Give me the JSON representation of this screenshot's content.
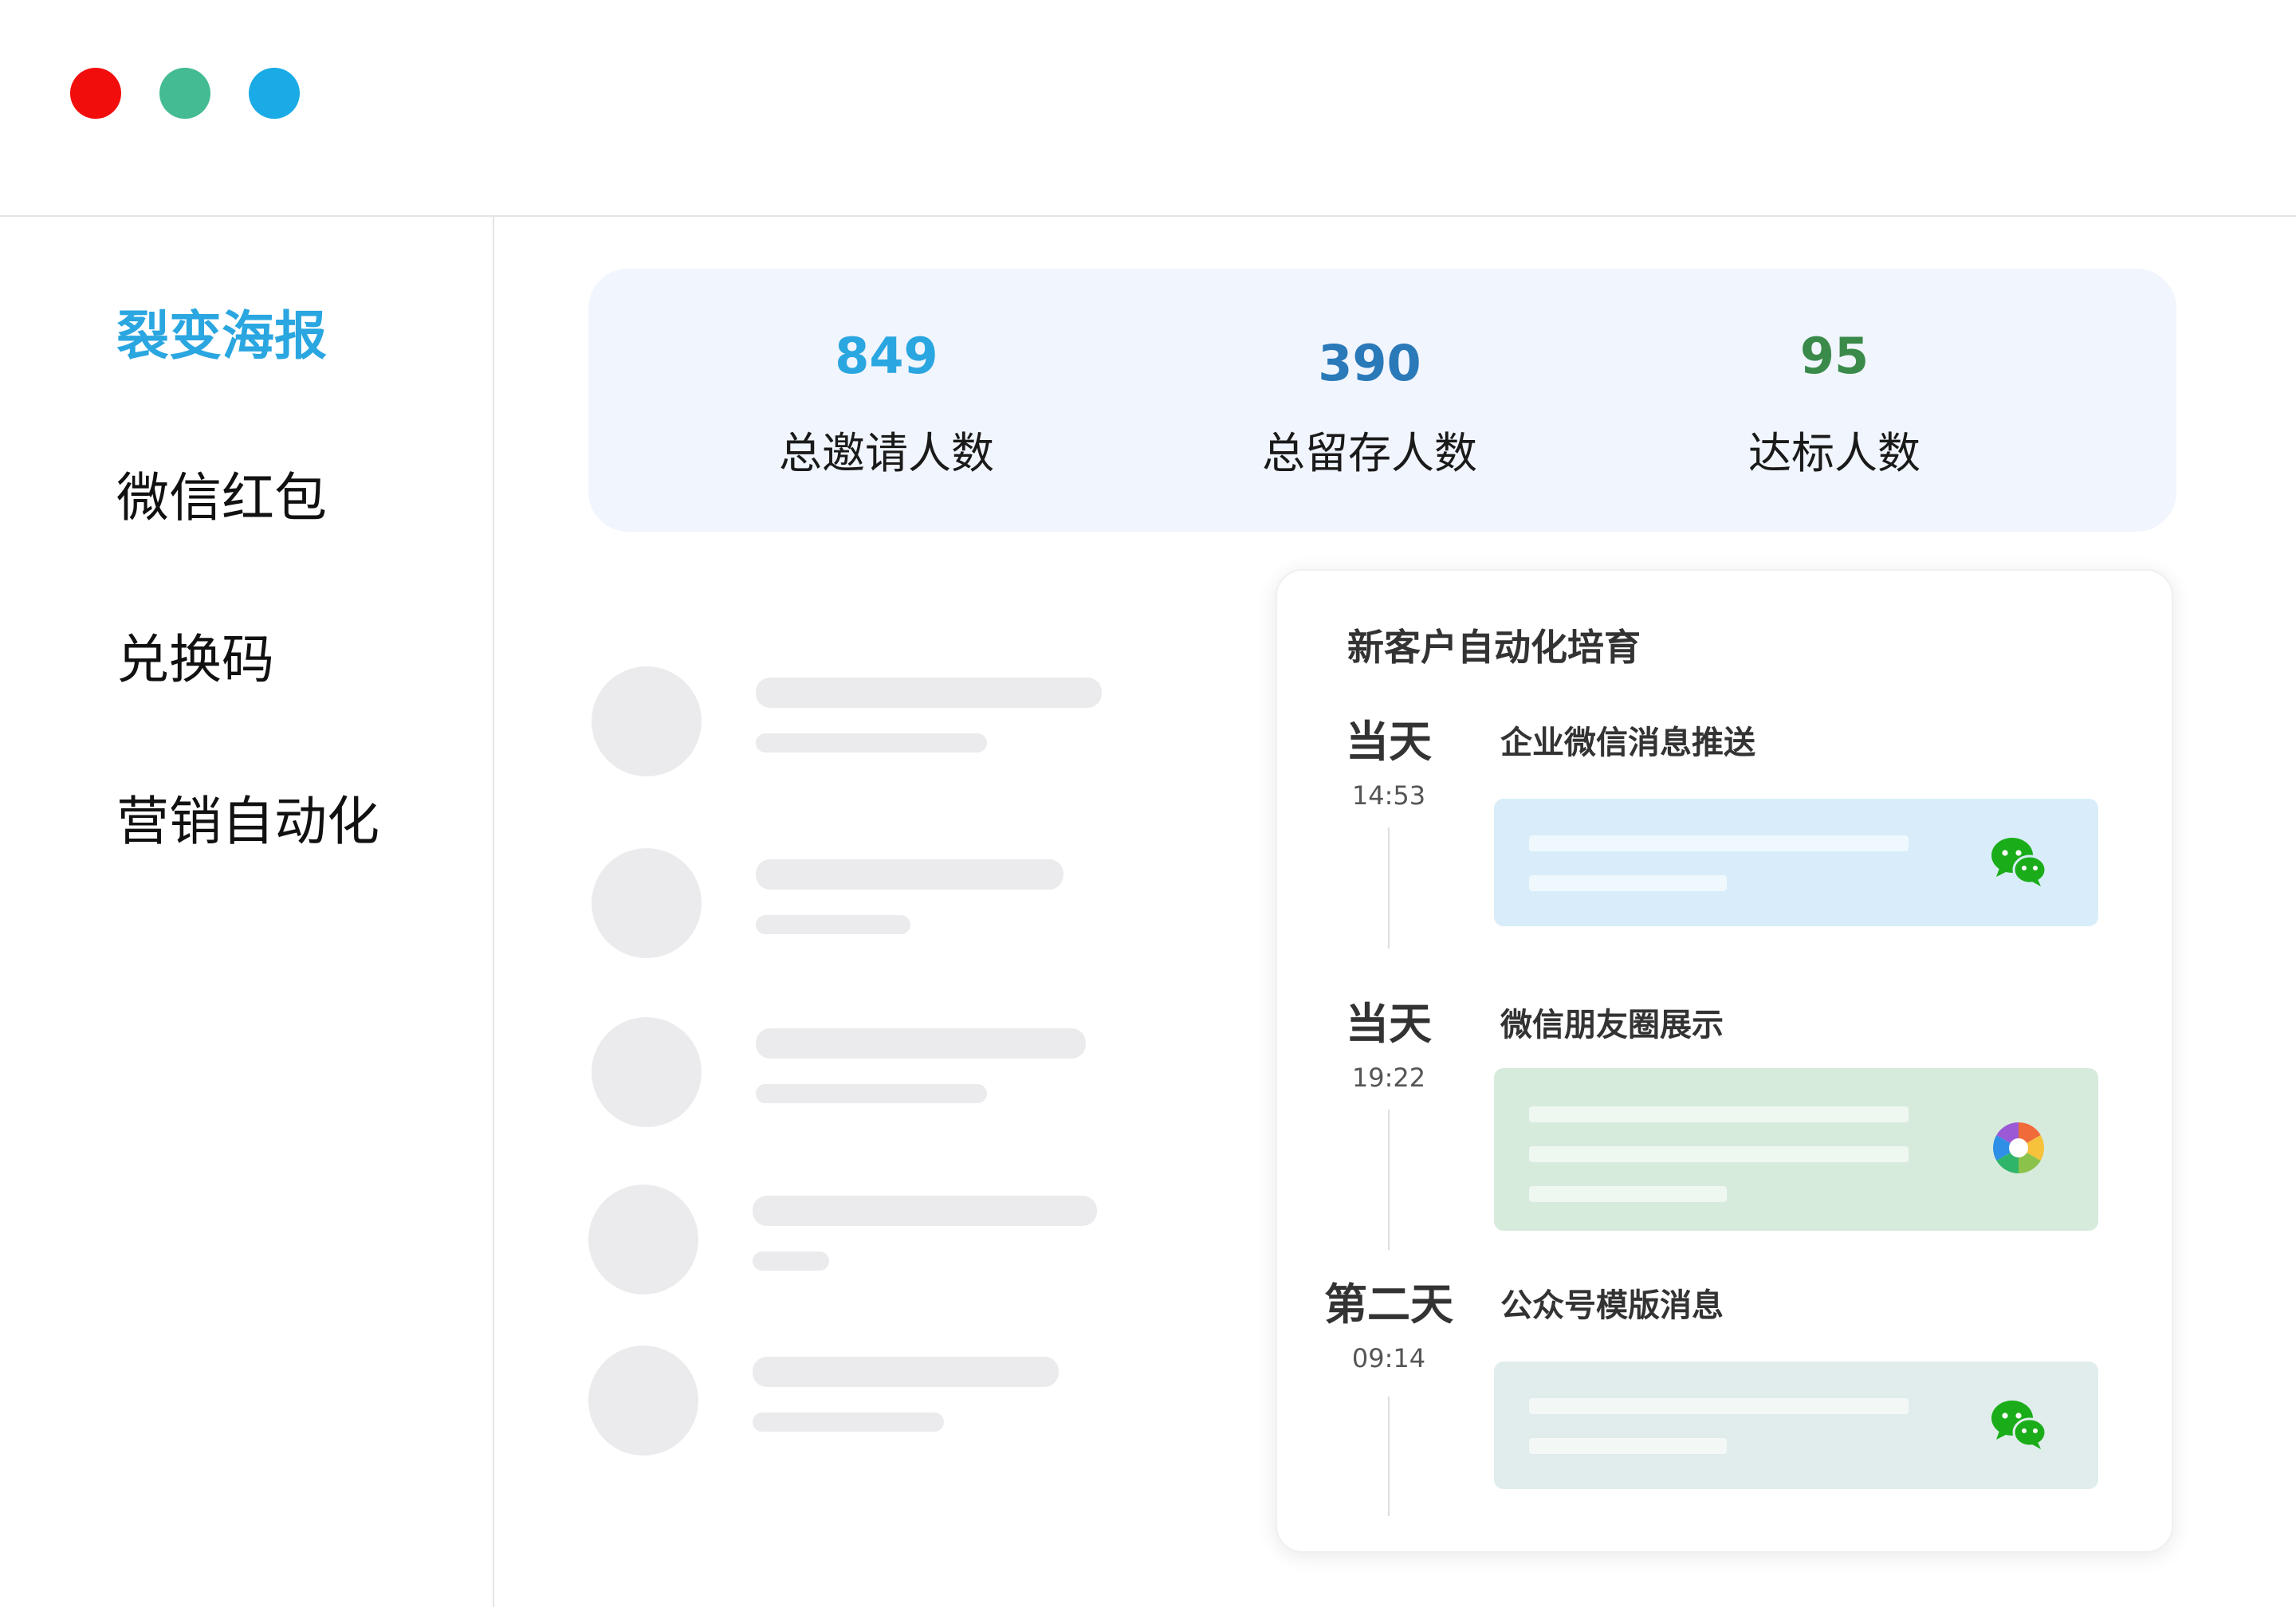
{
  "colors": {
    "close": "#f20d0d",
    "minimize": "#44bb93",
    "maximize": "#1aabe6",
    "nav_active": "#2aa6e0",
    "nav_default": "#111111",
    "stat_invites": "#2aa6e0",
    "stat_retained": "#2a79b8",
    "stat_qualified": "#3a8a4a",
    "box_blue": "#d8edf9",
    "box_green": "#d7ebdd",
    "box_teal": "#e0edec",
    "wechat_green": "#1aad19"
  },
  "window": {
    "controls": [
      "close-icon",
      "minimize-icon",
      "maximize-icon"
    ]
  },
  "sidebar": {
    "items": [
      {
        "label": "裂变海报",
        "active": true
      },
      {
        "label": "微信红包",
        "active": false
      },
      {
        "label": "兑换码",
        "active": false
      },
      {
        "label": "营销自动化",
        "active": false
      }
    ]
  },
  "stats": [
    {
      "value": "849",
      "label": "总邀请人数"
    },
    {
      "value": "390",
      "label": "总留存人数"
    },
    {
      "value": "95",
      "label": "达标人数"
    }
  ],
  "automation": {
    "title": "新客户自动化培育",
    "steps": [
      {
        "day": "当天",
        "time": "14:53",
        "name": "企业微信消息推送",
        "icon": "wechat-icon"
      },
      {
        "day": "当天",
        "time": "19:22",
        "name": "微信朋友圈展示",
        "icon": "moments-icon"
      },
      {
        "day": "第二天",
        "time": "09:14",
        "name": "公众号模版消息",
        "icon": "wechat-icon"
      }
    ]
  }
}
